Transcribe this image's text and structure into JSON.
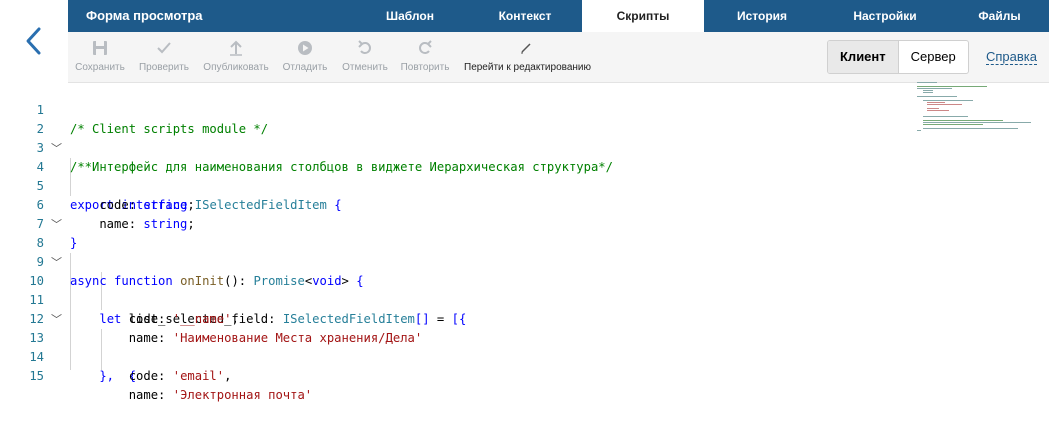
{
  "header": {
    "title": "Форма просмотра",
    "tabs": [
      "Шаблон",
      "Контекст",
      "Скрипты",
      "История",
      "Настройки",
      "Файлы"
    ],
    "active_tab": "Скрипты"
  },
  "toolbar": {
    "save": "Сохранить",
    "check": "Проверить",
    "publish": "Опубликовать",
    "debug": "Отладить",
    "undo": "Отменить",
    "redo": "Повторить",
    "edit": "Перейти к редактированию"
  },
  "mode": {
    "client": "Клиент",
    "server": "Сервер",
    "active": "Клиент"
  },
  "help_label": "Справка",
  "colors": {
    "nav_bg": "#1e5a8a",
    "comment": "#008000",
    "keyword": "#0000ff",
    "string": "#a31515",
    "type": "#267f99",
    "line_number": "#237893"
  },
  "editor": {
    "lines": [
      {
        "n": "1",
        "text": "/* Client scripts module */"
      },
      {
        "n": "2",
        "text": ""
      },
      {
        "n": "3",
        "text": "/**Интерфейс для наименования столбцов в виджете Иерархическая структура*/"
      },
      {
        "n": "4",
        "text": "export interface ISelectedFieldItem {"
      },
      {
        "n": "5",
        "text": "    code: string;"
      },
      {
        "n": "6",
        "text": "    name: string;"
      },
      {
        "n": "7",
        "text": "}"
      },
      {
        "n": "8",
        "text": "async function onInit(): Promise<void> {"
      },
      {
        "n": "9",
        "text": ""
      },
      {
        "n": "10",
        "text": "    let list_selected_field: ISelectedFieldItem[] = [{"
      },
      {
        "n": "11",
        "text": "        code: '__name',"
      },
      {
        "n": "12",
        "text": "        name: 'Наименование Места хранения/Дела'"
      },
      {
        "n": "13",
        "text": "    },  {"
      },
      {
        "n": "14",
        "text": "        code: 'email',"
      },
      {
        "n": "15",
        "text": "        name: 'Электронная почта'"
      }
    ]
  }
}
